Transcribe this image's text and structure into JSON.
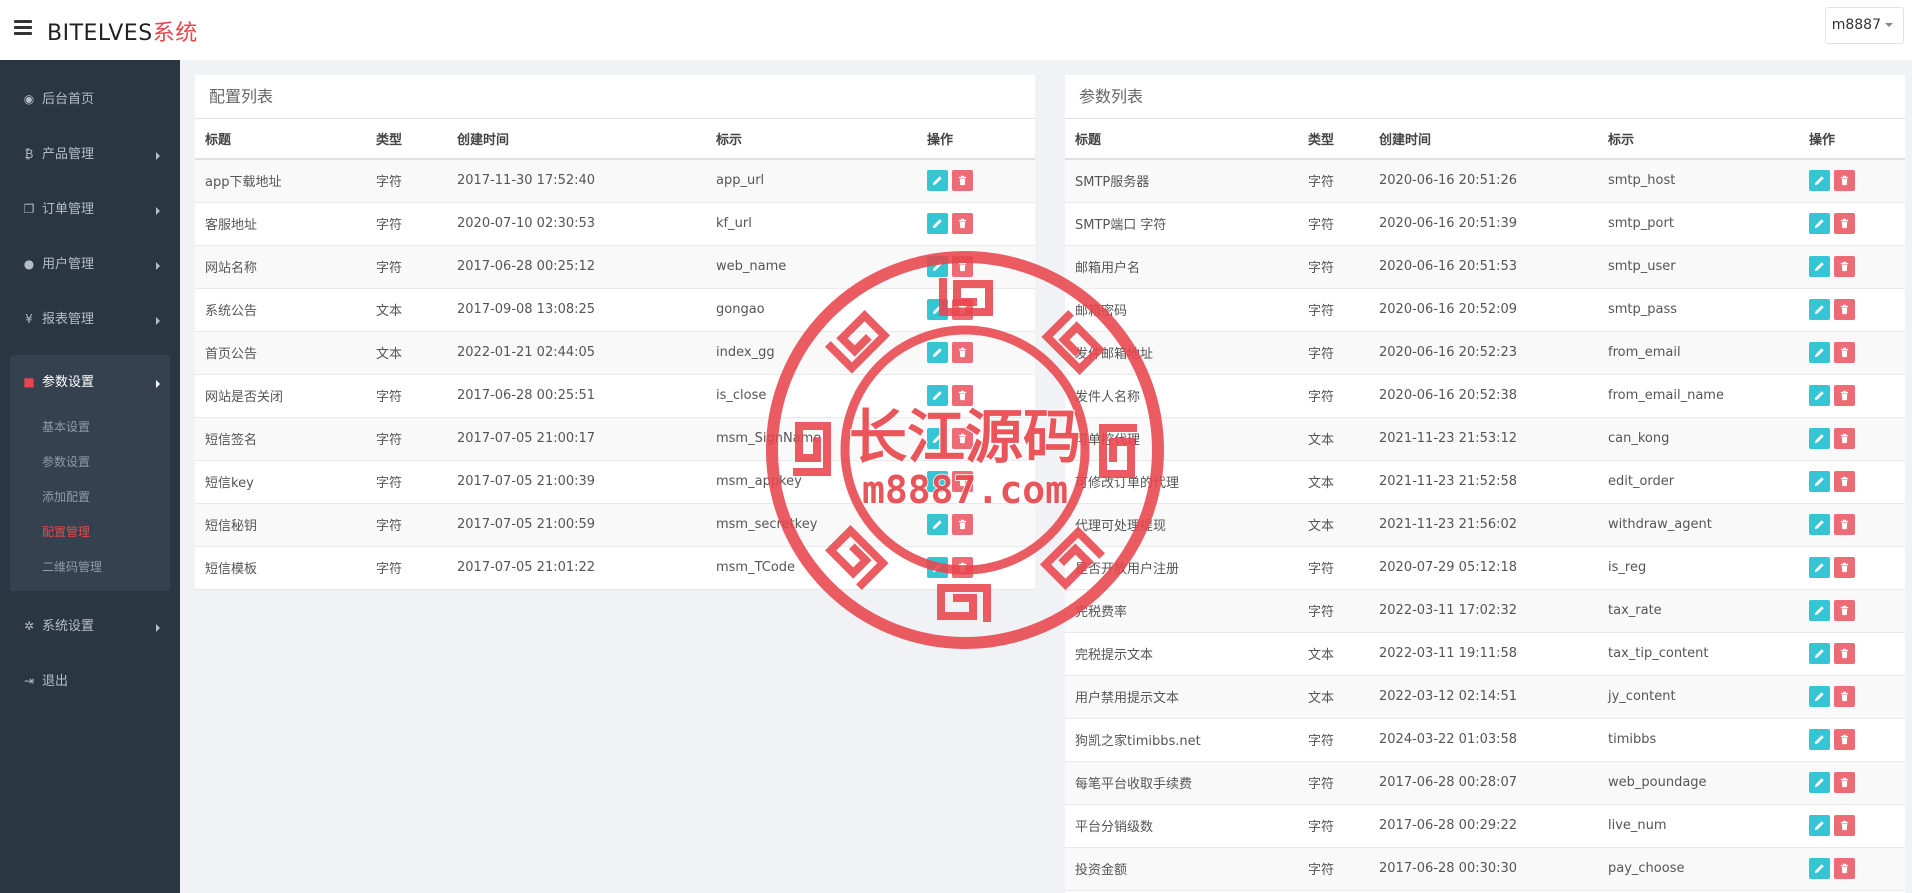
{
  "header": {
    "brand_main": "BITELVES",
    "brand_accent": "系统",
    "user": "m8887"
  },
  "sidebar": {
    "items": [
      {
        "label": "后台首页",
        "icon": "dashboard-icon"
      },
      {
        "label": "产品管理",
        "icon": "bitcoin-icon"
      },
      {
        "label": "订单管理",
        "icon": "copy-icon"
      },
      {
        "label": "用户管理",
        "icon": "user-icon"
      },
      {
        "label": "报表管理",
        "icon": "yen-icon"
      },
      {
        "label": "参数设置",
        "icon": "file-icon"
      },
      {
        "label": "系统设置",
        "icon": "cogs-icon"
      },
      {
        "label": "退出",
        "icon": "sign-out-icon"
      }
    ],
    "subitems": [
      "基本设置",
      "参数设置",
      "添加配置",
      "配置管理",
      "二维码管理"
    ]
  },
  "config_panel": {
    "title": "配置列表",
    "headers": [
      "标题",
      "类型",
      "创建时间",
      "标示",
      "操作"
    ],
    "rows": [
      [
        "app下载地址",
        "字符",
        "2017-11-30 17:52:40",
        "app_url"
      ],
      [
        "客服地址",
        "字符",
        "2020-07-10 02:30:53",
        "kf_url"
      ],
      [
        "网站名称",
        "字符",
        "2017-06-28 00:25:12",
        "web_name"
      ],
      [
        "系统公告",
        "文本",
        "2017-09-08 13:08:25",
        "gongao"
      ],
      [
        "首页公告",
        "文本",
        "2022-01-21 02:44:05",
        "index_gg"
      ],
      [
        "网站是否关闭",
        "字符",
        "2017-06-28 00:25:51",
        "is_close"
      ],
      [
        "短信签名",
        "字符",
        "2017-07-05 21:00:17",
        "msm_SignName"
      ],
      [
        "短信key",
        "字符",
        "2017-07-05 21:00:39",
        "msm_appkey"
      ],
      [
        "短信秘钥",
        "字符",
        "2017-07-05 21:00:59",
        "msm_secretkey"
      ],
      [
        "短信模板",
        "字符",
        "2017-07-05 21:01:22",
        "msm_TCode"
      ]
    ]
  },
  "param_panel": {
    "title": "参数列表",
    "headers": [
      "标题",
      "类型",
      "创建时间",
      "标示",
      "操作"
    ],
    "rows": [
      [
        "SMTP服务器",
        "字符",
        "2020-06-16 20:51:26",
        "smtp_host"
      ],
      [
        "SMTP端口 字符",
        "字符",
        "2020-06-16 20:51:39",
        "smtp_port"
      ],
      [
        "邮箱用户名",
        "字符",
        "2020-06-16 20:51:53",
        "smtp_user"
      ],
      [
        "邮箱密码",
        "字符",
        "2020-06-16 20:52:09",
        "smtp_pass"
      ],
      [
        "发件邮箱地址",
        "字符",
        "2020-06-16 20:52:23",
        "from_email"
      ],
      [
        "发件人名称",
        "字符",
        "2020-06-16 20:52:38",
        "from_email_name"
      ],
      [
        "可单控代理",
        "文本",
        "2021-11-23 21:53:12",
        "can_kong"
      ],
      [
        "可修改订单的代理",
        "文本",
        "2021-11-23 21:52:58",
        "edit_order"
      ],
      [
        "代理可处理提现",
        "文本",
        "2021-11-23 21:56:02",
        "withdraw_agent"
      ],
      [
        "是否开放用户注册",
        "字符",
        "2020-07-29 05:12:18",
        "is_reg"
      ],
      [
        "完税费率",
        "字符",
        "2022-03-11 17:02:32",
        "tax_rate"
      ],
      [
        "完税提示文本",
        "文本",
        "2022-03-11 19:11:58",
        "tax_tip_content"
      ],
      [
        "用户禁用提示文本",
        "文本",
        "2022-03-12 02:14:51",
        "jy_content"
      ],
      [
        "狗凯之家timibbs.net",
        "字符",
        "2024-03-22 01:03:58",
        "timibbs"
      ],
      [
        "每笔平台收取手续费",
        "字符",
        "2017-06-28 00:28:07",
        "web_poundage"
      ],
      [
        "平台分销级数",
        "字符",
        "2017-06-28 00:29:22",
        "live_num"
      ],
      [
        "投资金额",
        "字符",
        "2017-06-28 00:30:30",
        "pay_choose"
      ]
    ]
  },
  "watermark": {
    "title": "长江源码",
    "url": "m8887.com"
  },
  "colors": {
    "accent": "#e8464c",
    "sidebar_bg": "#2b3643",
    "edit_button": "#36c6d3",
    "delete_button": "#ed6b75"
  }
}
